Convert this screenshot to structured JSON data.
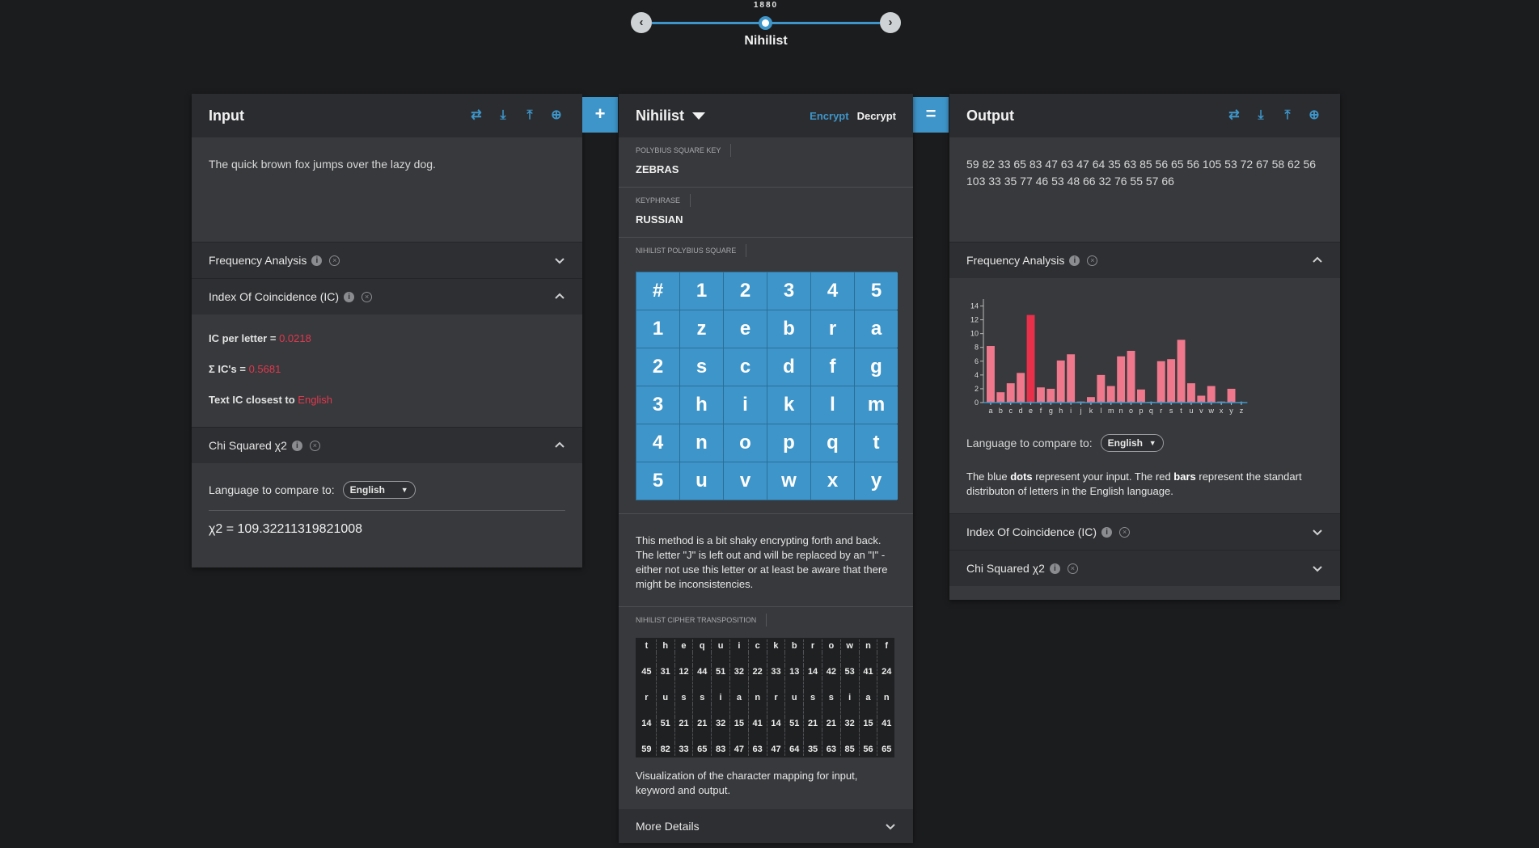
{
  "timeline": {
    "year": "1880",
    "cipher_name": "Nihilist"
  },
  "input": {
    "title": "Input",
    "text": "The quick brown fox jumps over the lazy dog.",
    "sections": {
      "freq": "Frequency Analysis",
      "ic": "Index Of Coincidence (IC)",
      "chi": "Chi Squared χ2"
    },
    "ic_per_letter_label": "IC per letter = ",
    "ic_per_letter_value": "0.0218",
    "sum_ic_label": "Σ IC's = ",
    "sum_ic_value": "0.5681",
    "closest_label": "Text IC closest to ",
    "closest_value": "English",
    "lang_label": "Language to compare to:",
    "lang_value": "English",
    "chi_result": "χ2 = 109.32211319821008"
  },
  "operators": {
    "plus": "+",
    "equals": "="
  },
  "cipher": {
    "title": "Nihilist",
    "encrypt": "Encrypt",
    "decrypt": "Decrypt",
    "key_label": "Polybius Square Key",
    "key_value": "ZEBRAS",
    "keyphrase_label": "Keyphrase",
    "keyphrase_value": "RUSSIAN",
    "square_label": "Nihilist Polybius Square",
    "square": [
      [
        "#",
        "1",
        "2",
        "3",
        "4",
        "5"
      ],
      [
        "1",
        "z",
        "e",
        "b",
        "r",
        "a"
      ],
      [
        "2",
        "s",
        "c",
        "d",
        "f",
        "g"
      ],
      [
        "3",
        "h",
        "i",
        "k",
        "l",
        "m"
      ],
      [
        "4",
        "n",
        "o",
        "p",
        "q",
        "t"
      ],
      [
        "5",
        "u",
        "v",
        "w",
        "x",
        "y"
      ]
    ],
    "note": "This method is a bit shaky encrypting forth and back. The letter \"J\" is left out and will be replaced by an \"I\" - either not use this letter or at least be aware that there might be inconsistencies.",
    "transposition_label": "Nihilist Cipher Transposition",
    "transposition": {
      "plain": [
        "t",
        "h",
        "e",
        "q",
        "u",
        "i",
        "c",
        "k",
        "b",
        "r",
        "o",
        "w",
        "n",
        "f"
      ],
      "plain_nums": [
        "45",
        "31",
        "12",
        "44",
        "51",
        "32",
        "22",
        "33",
        "13",
        "14",
        "42",
        "53",
        "41",
        "24"
      ],
      "key": [
        "r",
        "u",
        "s",
        "s",
        "i",
        "a",
        "n",
        "r",
        "u",
        "s",
        "s",
        "i",
        "a",
        "n"
      ],
      "key_nums": [
        "14",
        "51",
        "21",
        "21",
        "32",
        "15",
        "41",
        "14",
        "51",
        "21",
        "21",
        "32",
        "15",
        "41"
      ],
      "result": [
        "59",
        "82",
        "33",
        "65",
        "83",
        "47",
        "63",
        "47",
        "64",
        "35",
        "63",
        "85",
        "56",
        "65"
      ]
    },
    "viz_note": "Visualization of the character mapping for input, keyword and output.",
    "more_details": "More Details"
  },
  "output": {
    "title": "Output",
    "text": "59 82 33 65 83 47 63 47 64 35 63 85 56 65 56 105 53 72 67 58 62 56 103 33 35 77 46 53 48 66 32 76 55 57 66",
    "sections": {
      "freq": "Frequency Analysis",
      "ic": "Index Of Coincidence (IC)",
      "chi": "Chi Squared χ2"
    },
    "lang_label": "Language to compare to:",
    "lang_value": "English",
    "legend_part1": "The blue ",
    "legend_dots": "dots",
    "legend_part2": " represent your input. The red ",
    "legend_bars": "bars",
    "legend_part3": " represent the standart distributon of letters in the English language."
  },
  "chart_data": {
    "type": "bar",
    "categories": [
      "a",
      "b",
      "c",
      "d",
      "e",
      "f",
      "g",
      "h",
      "i",
      "j",
      "k",
      "l",
      "m",
      "n",
      "o",
      "p",
      "q",
      "r",
      "s",
      "t",
      "u",
      "v",
      "w",
      "x",
      "y",
      "z"
    ],
    "series": [
      {
        "values": [
          8.2,
          1.5,
          2.8,
          4.3,
          12.7,
          2.2,
          2.0,
          6.1,
          7.0,
          0.15,
          0.8,
          4.0,
          2.4,
          6.7,
          7.5,
          1.9,
          0.1,
          6.0,
          6.3,
          9.1,
          2.8,
          1.0,
          2.4,
          0.15,
          2.0,
          0.07
        ]
      }
    ],
    "ylim": [
      0,
      15
    ],
    "yticks": [
      "0",
      "2",
      "4",
      "6",
      "8",
      "10",
      "12",
      "14"
    ],
    "bar_color": "#f0788c",
    "highlight_color": "#e8304a",
    "dot_color": "#3e95c9"
  },
  "icons": {
    "swap": "swap-icon",
    "download": "download-icon",
    "upload": "upload-icon",
    "add": "add-circle-icon"
  }
}
